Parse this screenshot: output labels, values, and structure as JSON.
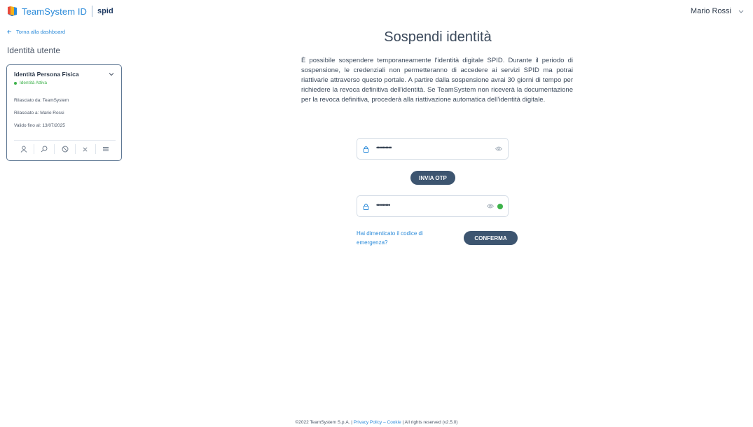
{
  "header": {
    "logo_text": "TeamSystem ID",
    "spid_text": "spid",
    "user_name": "Mario Rossi"
  },
  "sidebar": {
    "back_link": "Torna alla dashboard",
    "title": "Identità utente",
    "card": {
      "title": "Identità Persona Fisica",
      "status": "Identità Attiva",
      "issued_by": "Rilasciato da: TeamSystem",
      "issued_to": "Rilasciato a: Mario Rossi",
      "valid_until": "Valido fino al: 13/07/2025",
      "actions": [
        "user-icon",
        "search-icon",
        "block-icon",
        "close-icon",
        "list-icon"
      ]
    }
  },
  "main": {
    "title": "Sospendi identità",
    "description": "È possibile sospendere temporaneamente l'identità digitale SPID. Durante il periodo di sospensione, le credenziali non permetteranno di accedere ai servizi SPID ma potrai riattivarle attraverso questo portale. A partire dalla sospensione avrai 30 giorni di tempo per richiedere la revoca definitiva dell'identità. Se TeamSystem non riceverà la documentazione per la revoca definitiva, procederà alla riattivazione automatica dell'identità digitale.",
    "password_value": "••••••••••",
    "otp_button": "INVIA OTP",
    "otp_value": "•••••••••",
    "forgot_link": "Hai dimenticato il codice di emergenza?",
    "confirm_button": "CONFERMA"
  },
  "footer": {
    "copyright": "©2022 TeamSystem S.p.A. |",
    "privacy": "Privacy Policy",
    "dash": "–",
    "cookie": "Cookie",
    "rights": "| All rights reserved (v2.5.0)"
  },
  "colors": {
    "accent": "#2a8ad9",
    "button": "#3d5570",
    "status_green": "#3db24a"
  }
}
